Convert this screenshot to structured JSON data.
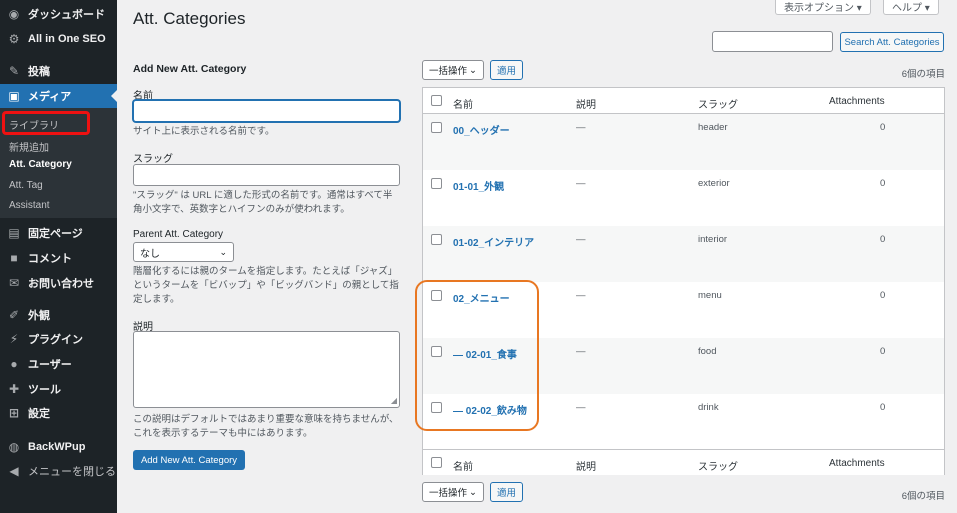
{
  "sidebar": {
    "items": [
      {
        "icon": "dashboard-icon",
        "glyph": "◉",
        "label": "ダッシュボード"
      },
      {
        "icon": "gear-icon",
        "glyph": "⚙",
        "label": "All in One SEO"
      },
      {
        "icon": "pin-icon",
        "glyph": "✎",
        "label": "投稿"
      },
      {
        "icon": "media-icon",
        "glyph": "▣",
        "label": "メディア"
      },
      {
        "icon": "page-icon",
        "glyph": "▤",
        "label": "固定ページ"
      },
      {
        "icon": "comment-icon",
        "glyph": "■",
        "label": "コメント"
      },
      {
        "icon": "mail-icon",
        "glyph": "✉",
        "label": "お問い合わせ"
      },
      {
        "icon": "brush-icon",
        "glyph": "✐",
        "label": "外観"
      },
      {
        "icon": "plugin-icon",
        "glyph": "⚡",
        "label": "プラグイン"
      },
      {
        "icon": "user-icon",
        "glyph": "●",
        "label": "ユーザー"
      },
      {
        "icon": "wrench-icon",
        "glyph": "✚",
        "label": "ツール"
      },
      {
        "icon": "settings-icon",
        "glyph": "⊞",
        "label": "設定"
      },
      {
        "icon": "backup-icon",
        "glyph": "◍",
        "label": "BackWPup"
      },
      {
        "icon": "collapse-icon",
        "glyph": "◀",
        "label": "メニューを閉じる"
      }
    ],
    "submenu": [
      "ライブラリ",
      "新規追加",
      "Att. Category",
      "Att. Tag",
      "Assistant"
    ]
  },
  "header": {
    "title": "Att. Categories",
    "screen_options": "表示オプション ▾",
    "help": "ヘルプ ▾"
  },
  "search": {
    "button": "Search Att. Categories",
    "placeholder": ""
  },
  "form": {
    "heading": "Add New Att. Category",
    "name_label": "名前",
    "name_desc": "サイト上に表示される名前です。",
    "slug_label": "スラッグ",
    "slug_desc": "\"スラッグ\" は URL に適した形式の名前です。通常はすべて半角小文字で、英数字とハイフンのみが使われます。",
    "parent_label": "Parent Att. Category",
    "parent_value": "なし",
    "parent_desc": "階層化するには親のタームを指定します。たとえば「ジャズ」というタームを「ビバップ」や「ビッグバンド」の親として指定します。",
    "desc_label": "説明",
    "desc_desc": "この説明はデフォルトではあまり重要な意味を持ちませんが、これを表示するテーマも中にはあります。",
    "submit": "Add New Att. Category"
  },
  "bulk": {
    "select": "一括操作",
    "apply": "適用",
    "count": "6個の項目"
  },
  "table": {
    "columns": {
      "name": "名前",
      "description": "説明",
      "slug": "スラッグ",
      "count": "Attachments"
    },
    "rows": [
      {
        "name": "00_ヘッダー",
        "description": "—",
        "slug": "header",
        "count": "0"
      },
      {
        "name": "01-01_外観",
        "description": "—",
        "slug": "exterior",
        "count": "0"
      },
      {
        "name": "01-02_インテリア",
        "description": "—",
        "slug": "interior",
        "count": "0"
      },
      {
        "name": "02_メニュー",
        "description": "—",
        "slug": "menu",
        "count": "0"
      },
      {
        "name": "— 02-01_食事",
        "description": "—",
        "slug": "food",
        "count": "0"
      },
      {
        "name": "— 02-02_飲み物",
        "description": "—",
        "slug": "drink",
        "count": "0"
      }
    ]
  },
  "colors": {
    "accent": "#2271b1",
    "sidebar": "#1d2327",
    "highlight_red": "#e11111",
    "highlight_orange": "#e87722"
  }
}
